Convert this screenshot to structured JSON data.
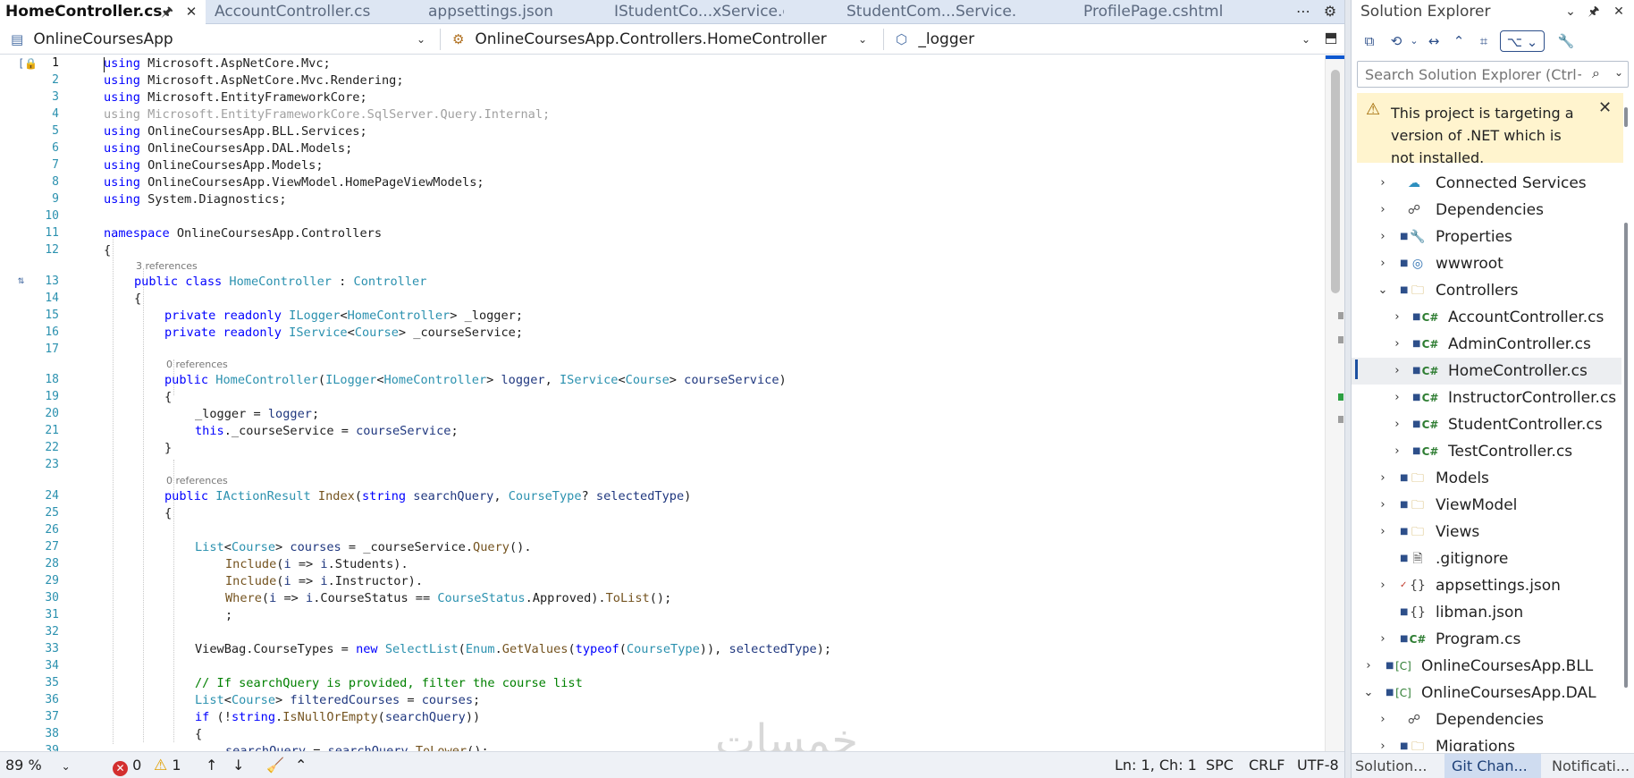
{
  "tabs": {
    "active": "HomeController.cs",
    "others": [
      "AccountController.cs",
      "appsettings.json",
      "IStudentCo...xService.cs",
      "StudentCom...Service.cs",
      "ProfilePage.cshtml"
    ]
  },
  "navbar": {
    "project": "OnlineCoursesApp",
    "type": "OnlineCoursesApp.Controllers.HomeController",
    "member": "_logger"
  },
  "code": {
    "line_numbers": [
      "1",
      "2",
      "3",
      "4",
      "5",
      "6",
      "7",
      "8",
      "9",
      "10",
      "11",
      "12",
      "13",
      "14",
      "15",
      "16",
      "17",
      "18",
      "19",
      "20",
      "21",
      "22",
      "23",
      "24",
      "25",
      "26",
      "27",
      "28",
      "29",
      "30",
      "31",
      "32",
      "33",
      "34",
      "35",
      "36",
      "37",
      "38",
      "39"
    ],
    "refs_3": "3 references",
    "refs_0a": "0 references",
    "refs_0b": "0 references",
    "l1a": "using",
    "l1b": " Microsoft.AspNetCore.Mvc;",
    "l2a": "using",
    "l2b": " Microsoft.AspNetCore.Mvc.Rendering;",
    "l3a": "using",
    "l3b": " Microsoft.EntityFrameworkCore;",
    "l4": "using Microsoft.EntityFrameworkCore.SqlServer.Query.Internal;",
    "l5a": "using",
    "l5b": " OnlineCoursesApp.BLL.Services;",
    "l6a": "using",
    "l6b": " OnlineCoursesApp.DAL.Models;",
    "l7a": "using",
    "l7b": " OnlineCoursesApp.Models;",
    "l8a": "using",
    "l8b": " OnlineCoursesApp.ViewModel.HomePageViewModels;",
    "l9a": "using",
    "l9b": " System.Diagnostics;",
    "l11a": "namespace",
    "l11b": " OnlineCoursesApp.Controllers",
    "l12": "{",
    "l13a": "public class ",
    "l13b": "HomeController",
    "l13c": " : ",
    "l13d": "Controller",
    "l14": "{",
    "l15a": "private readonly ",
    "l15b": "ILogger",
    "l15c": "<",
    "l15d": "HomeController",
    "l15e": "> _logger;",
    "l16a": "private readonly ",
    "l16b": "IService",
    "l16c": "<",
    "l16d": "Course",
    "l16e": "> _courseService;",
    "l18a": "public ",
    "l18b": "HomeController",
    "l18c": "(",
    "l18d": "ILogger",
    "l18e": "<",
    "l18f": "HomeController",
    "l18g": "> ",
    "l18h": "logger",
    "l18i": ", ",
    "l18j": "IService",
    "l18k": "<",
    "l18l": "Course",
    "l18m": "> ",
    "l18n": "courseService",
    "l18o": ")",
    "l19": "{",
    "l20a": "_logger = ",
    "l20b": "logger",
    "l20c": ";",
    "l21a": "this",
    "l21b": "._courseService = ",
    "l21c": "courseService",
    "l21d": ";",
    "l22": "}",
    "l24a": "public ",
    "l24b": "IActionResult",
    "l24c": " ",
    "l24d": "Index",
    "l24e": "(",
    "l24f": "string",
    "l24g": " ",
    "l24h": "searchQuery",
    "l24i": ", ",
    "l24j": "CourseType",
    "l24k": "? ",
    "l24l": "selectedType",
    "l24m": ")",
    "l25": "{",
    "l27a": "List",
    "l27b": "<",
    "l27c": "Course",
    "l27d": "> ",
    "l27e": "courses",
    "l27f": " = _courseService.",
    "l27g": "Query",
    "l27h": "().",
    "l28a": "Include",
    "l28b": "(",
    "l28c": "i",
    "l28d": " => ",
    "l28e": "i",
    "l28f": ".Students).",
    "l29a": "Include",
    "l29b": "(",
    "l29c": "i",
    "l29d": " => ",
    "l29e": "i",
    "l29f": ".Instructor).",
    "l30a": "Where",
    "l30b": "(",
    "l30c": "i",
    "l30d": " => ",
    "l30e": "i",
    "l30f": ".CourseStatus == ",
    "l30g": "CourseStatus",
    "l30h": ".Approved).",
    "l30i": "ToList",
    "l30j": "();",
    "l31": ";",
    "l33a": "ViewBag.CourseTypes = ",
    "l33b": "new ",
    "l33c": "SelectList",
    "l33d": "(",
    "l33e": "Enum",
    "l33f": ".",
    "l33g": "GetValues",
    "l33h": "(",
    "l33i": "typeof",
    "l33j": "(",
    "l33k": "CourseType",
    "l33l": ")), ",
    "l33m": "selectedType",
    "l33n": ");",
    "l35": "// If searchQuery is provided, filter the course list",
    "l36a": "List",
    "l36b": "<",
    "l36c": "Course",
    "l36d": "> ",
    "l36e": "filteredCourses",
    "l36f": " = ",
    "l36g": "courses",
    "l36h": ";",
    "l37a": "if",
    "l37b": " (!",
    "l37c": "string",
    "l37d": ".",
    "l37e": "IsNullOrEmpty",
    "l37f": "(",
    "l37g": "searchQuery",
    "l37h": "))",
    "l38": "{",
    "l39a": "searchQuery",
    "l39b": " = ",
    "l39c": "searchQuery",
    "l39d": ".",
    "l39e": "ToLower",
    "l39f": "();"
  },
  "status": {
    "zoom": "89 %",
    "errors": "0",
    "warnings": "1",
    "position": "Ln: 1, Ch: 1",
    "spc": "SPC",
    "eol": "CRLF",
    "encoding": "UTF-8"
  },
  "watermark": "خمسات",
  "solution_explorer": {
    "title": "Solution Explorer",
    "search_placeholder": "Search Solution Explorer (Ctrl+;)",
    "warning": "This project is targeting a version of .NET which is not installed.",
    "tree": [
      {
        "label": "Connected Services"
      },
      {
        "label": "Dependencies"
      },
      {
        "label": "Properties"
      },
      {
        "label": "wwwroot"
      },
      {
        "label": "Controllers"
      },
      {
        "label": "AccountController.cs"
      },
      {
        "label": "AdminController.cs"
      },
      {
        "label": "HomeController.cs"
      },
      {
        "label": "InstructorController.cs"
      },
      {
        "label": "StudentController.cs"
      },
      {
        "label": "TestController.cs"
      },
      {
        "label": "Models"
      },
      {
        "label": "ViewModel"
      },
      {
        "label": "Views"
      },
      {
        "label": ".gitignore"
      },
      {
        "label": "appsettings.json"
      },
      {
        "label": "libman.json"
      },
      {
        "label": "Program.cs"
      },
      {
        "label": "OnlineCoursesApp.BLL"
      },
      {
        "label": "OnlineCoursesApp.DAL"
      },
      {
        "label": "Dependencies"
      },
      {
        "label": "Migrations"
      }
    ],
    "bottom_tabs": [
      "Solution...",
      "Git Chan...",
      "Notificati..."
    ]
  }
}
